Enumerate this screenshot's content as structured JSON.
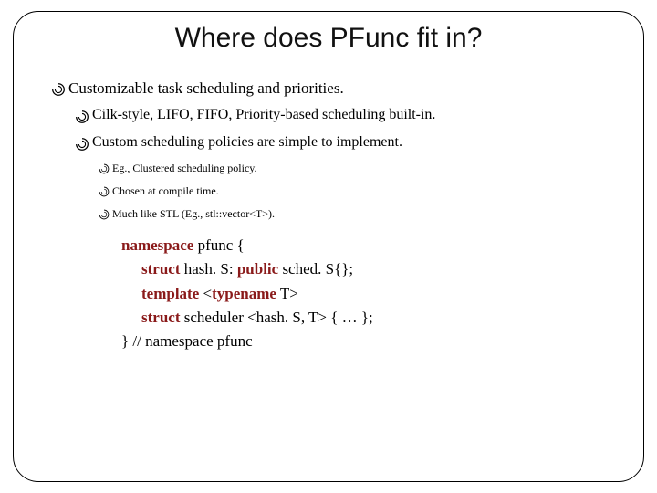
{
  "title": "Where does PFunc fit in?",
  "b0": "Customizable task scheduling and priorities.",
  "b1a": "Cilk-style, LIFO, FIFO, Priority-based scheduling built-in.",
  "b1b": "Custom scheduling policies are simple to implement.",
  "b2a": "Eg., Clustered scheduling policy.",
  "b2b": "Chosen at compile time.",
  "b2c": "Much like STL (Eg., stl::vector<T>).",
  "code": {
    "kw_namespace": "namespace",
    "ns_name": " pfunc {",
    "kw_struct1": "struct",
    "struct1_mid": " hash. S: ",
    "kw_public": "public",
    "struct1_end": " sched. S{};",
    "kw_template": "template",
    "tmpl_open": " <",
    "kw_typename": "typename",
    "tmpl_close": " T>",
    "kw_struct2": "struct",
    "struct2_end": " scheduler <hash. S, T> { … };",
    "close": "} // namespace pfunc"
  }
}
